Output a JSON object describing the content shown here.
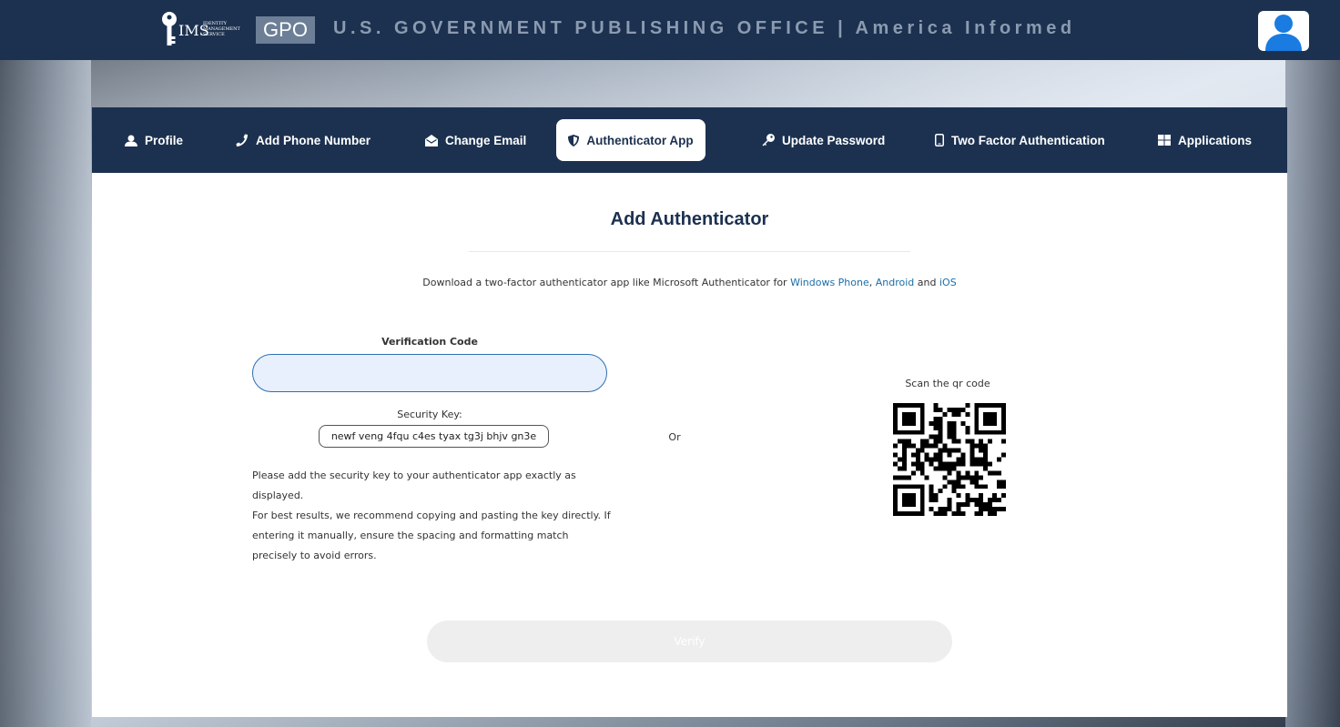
{
  "header": {
    "logo_ims": "IMS",
    "logo_ims_sub": "IDENTITY MANAGEMENT SERVICE",
    "logo_gpo": "GPO",
    "title": "U.S. GOVERNMENT PUBLISHING OFFICE  |  America Informed"
  },
  "tabs": [
    {
      "label": "Profile",
      "icon": "user-icon",
      "active": false
    },
    {
      "label": "Add Phone Number",
      "icon": "phone-icon",
      "active": false
    },
    {
      "label": "Change Email",
      "icon": "envelope-open-icon",
      "active": false
    },
    {
      "label": "Authenticator App",
      "icon": "shield-icon",
      "active": true
    },
    {
      "label": "Update Password",
      "icon": "key-icon",
      "active": false
    },
    {
      "label": "Two Factor Authentication",
      "icon": "mobile-icon",
      "active": false
    },
    {
      "label": "Applications",
      "icon": "grid-icon",
      "active": false
    }
  ],
  "main": {
    "title": "Add Authenticator",
    "download_prefix": "Download a two-factor authenticator app like Microsoft Authenticator for ",
    "link_windows": "Windows Phone",
    "sep1": ", ",
    "link_android": "Android",
    "sep2": " and ",
    "link_ios": "iOS",
    "verification_label": "Verification Code",
    "verification_value": "",
    "security_key_label": "Security Key:",
    "security_key": "newf veng 4fqu c4es tyax tg3j bhjv gn3e",
    "instruction_1": "Please add the security key to your authenticator app exactly as displayed.",
    "instruction_2": "For best results, we recommend copying and pasting the key directly. If entering it manually, ensure the spacing and formatting match precisely to avoid errors.",
    "or_label": "Or",
    "scan_label": "Scan the qr code",
    "verify_label": "Verify"
  },
  "colors": {
    "navy": "#1c3150",
    "link": "#1a6ea8",
    "input_border": "#2e6fb0",
    "avatar_blue": "#1a7be0"
  }
}
